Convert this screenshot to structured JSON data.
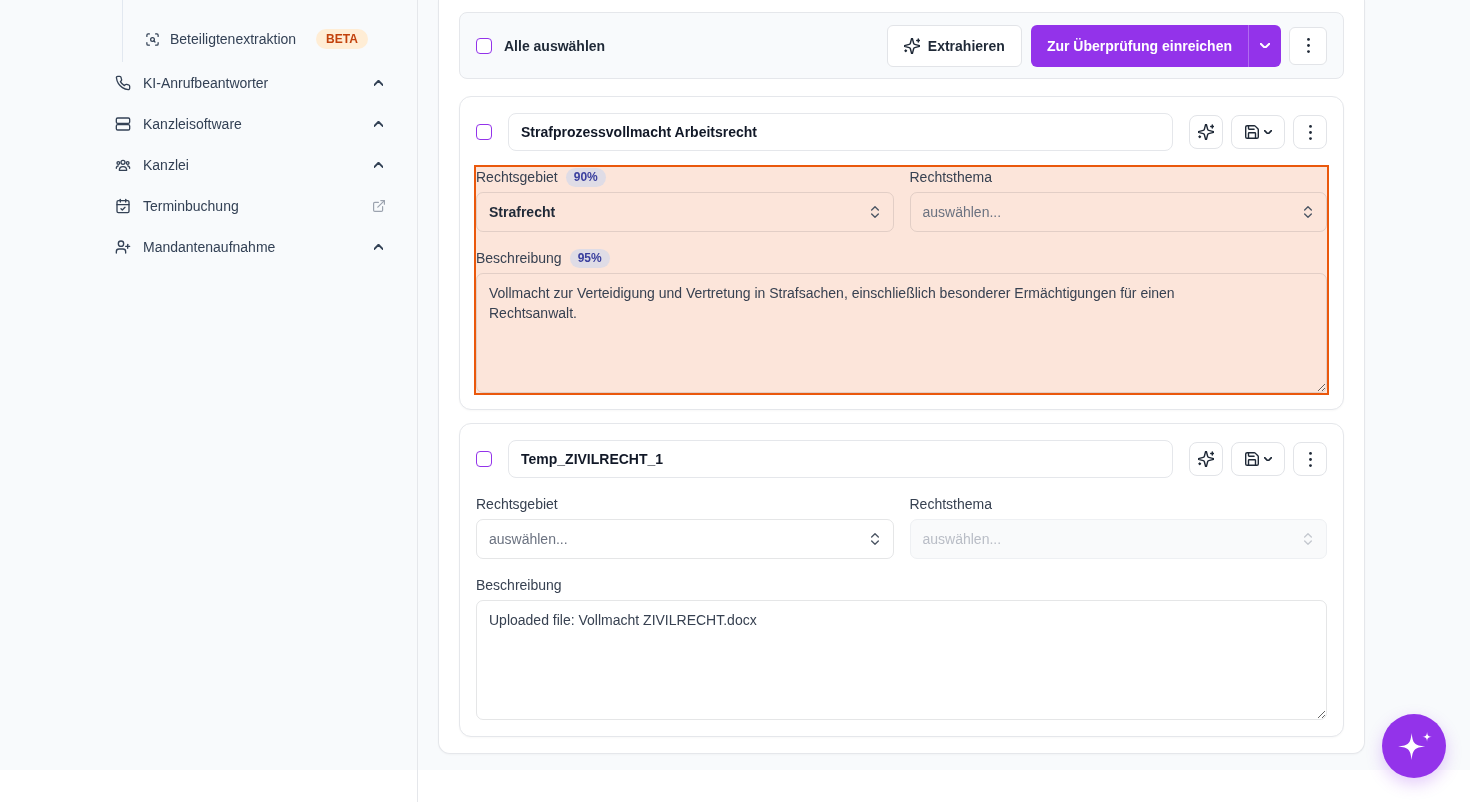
{
  "sidebar": {
    "sub_items": [
      {
        "label": "Beteiligtenextraktion",
        "badge": "BETA"
      }
    ],
    "items": [
      {
        "label": "KI-Anrufbeantworter",
        "kind": "group"
      },
      {
        "label": "Kanzleisoftware",
        "kind": "group"
      },
      {
        "label": "Kanzlei",
        "kind": "group"
      },
      {
        "label": "Terminbuchung",
        "kind": "link"
      },
      {
        "label": "Mandantenaufnahme",
        "kind": "group"
      }
    ]
  },
  "toolbar": {
    "select_all": {
      "label": "Alle auswählen",
      "checked": false
    },
    "extract_button": "Extrahieren",
    "submit_button": "Zur Überprüfung einreichen"
  },
  "documents": [
    {
      "checked": false,
      "title": "Strafprozessvollmacht Arbeitsrecht",
      "highlighted": true,
      "fields": [
        {
          "kind": "select",
          "label": "Rechtsgebiet",
          "confidence": "90%",
          "value": "Strafrecht",
          "disabled": false
        },
        {
          "kind": "select",
          "label": "Rechtsthema",
          "placeholder": "auswählen...",
          "disabled": false
        },
        {
          "kind": "textarea",
          "label": "Beschreibung",
          "confidence": "95%",
          "value": "Vollmacht zur Verteidigung und Vertretung in Strafsachen, einschließlich besonderer Ermächtigungen für einen Rechtsanwalt."
        }
      ]
    },
    {
      "checked": false,
      "title": "Temp_ZIVILRECHT_1",
      "highlighted": false,
      "fields": [
        {
          "kind": "select",
          "label": "Rechtsgebiet",
          "placeholder": "auswählen...",
          "disabled": false
        },
        {
          "kind": "select",
          "label": "Rechtsthema",
          "placeholder": "auswählen...",
          "disabled": true
        },
        {
          "kind": "textarea",
          "label": "Beschreibung",
          "value": "Uploaded file: Vollmacht ZIVILRECHT.docx"
        }
      ]
    }
  ]
}
